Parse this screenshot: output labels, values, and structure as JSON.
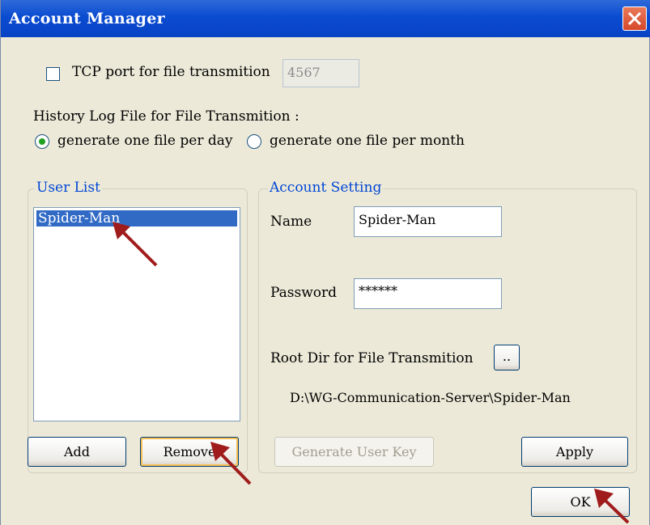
{
  "window": {
    "title": "Account Manager"
  },
  "tcp": {
    "label": "TCP port for file transmition",
    "port_value": "4567",
    "checked": false
  },
  "history": {
    "label": "History Log File for File Transmition :",
    "options": [
      {
        "label": "generate one file per day",
        "selected": true
      },
      {
        "label": "generate one file per month",
        "selected": false
      }
    ]
  },
  "user_list": {
    "legend": "User List",
    "items": [
      "Spider-Man"
    ],
    "add_label": "Add",
    "remove_label": "Remove"
  },
  "account_setting": {
    "legend": "Account Setting",
    "name_label": "Name",
    "name_value": "Spider-Man",
    "password_label": "Password",
    "password_value": "******",
    "root_dir_label": "Root Dir for File Transmition",
    "browse_label": "..",
    "root_dir_path": "D:\\WG-Communication-Server\\Spider-Man",
    "generate_key_label": "Generate User Key",
    "apply_label": "Apply"
  },
  "footer": {
    "ok_label": "OK"
  },
  "colors": {
    "titlebar": "#0a4cd1",
    "selection": "#316ac5",
    "legend_text": "#0046d5",
    "annotation_arrow": "#a01c1c"
  }
}
